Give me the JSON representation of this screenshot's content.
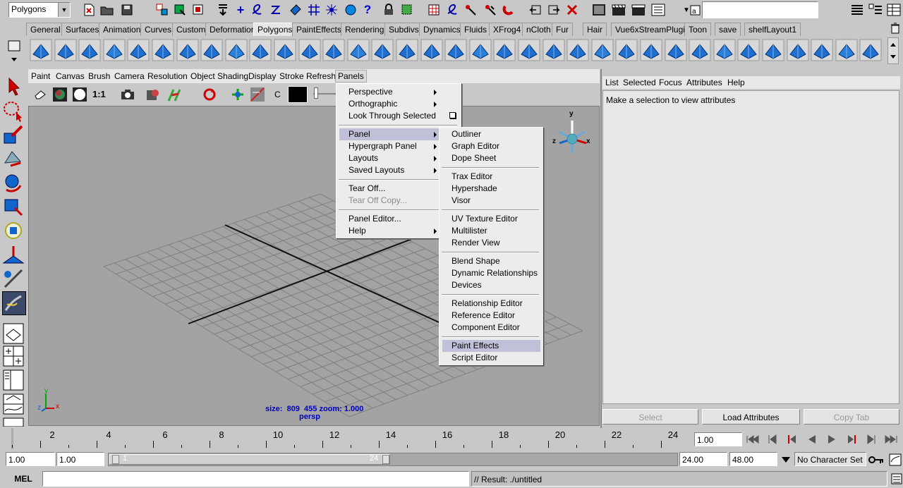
{
  "status_line": {
    "mode_selector": "Polygons",
    "quick_field": "",
    "icons": [
      "new-scene-icon",
      "open-scene-icon",
      "save-scene-icon",
      "select-by-hierarchy-icon",
      "select-by-object-icon",
      "select-by-component-icon",
      "snap-grid-icon",
      "snap-curve-icon",
      "snap-point-icon",
      "snap-plane-icon",
      "make-live-icon",
      "construction-history-icon",
      "render-icon",
      "ipr-render-icon",
      "render-globals-icon",
      "show-hypershade-icon",
      "render-view-icon",
      "magnet-icon",
      "quick-field-type-icon"
    ]
  },
  "shelf": {
    "tabs": [
      "General",
      "Surfaces",
      "Animation",
      "Curves",
      "Custom",
      "Deformation",
      "Polygons",
      "PaintEffects",
      "Rendering",
      "Subdivs",
      "Dynamics",
      "Fluids",
      "XFrog4",
      "nCloth",
      "Fur",
      "Hair",
      "Vue6xStreamPlugin",
      "Toon",
      "save",
      "shelfLayout1"
    ],
    "active_tab": "Polygons"
  },
  "panel_menubar": [
    "Paint",
    "Canvas",
    "Brush",
    "Camera",
    "Resolution",
    "Object Shading",
    "Display",
    "Stroke Refresh",
    "Panels"
  ],
  "panel_toolbar": {
    "label_c": "C",
    "ratio_label": "1:1"
  },
  "viewport": {
    "size_readout": "size:  809  455 zoom: 1.000",
    "camera_label": "persp",
    "axis_y": "y",
    "axis_x": "x",
    "axis_z": "z"
  },
  "panels_menu": {
    "items": [
      {
        "label": "Perspective",
        "submenu": true
      },
      {
        "label": "Orthographic",
        "submenu": true
      },
      {
        "label": "Look Through Selected",
        "option_box": true
      },
      {
        "label": "Panel",
        "submenu": true,
        "highlighted": true
      },
      {
        "label": "Hypergraph Panel",
        "submenu": true
      },
      {
        "label": "Layouts",
        "submenu": true
      },
      {
        "label": "Saved Layouts",
        "submenu": true
      },
      {
        "label": "Tear Off..."
      },
      {
        "label": "Tear Off Copy...",
        "disabled": true
      },
      {
        "label": "Panel Editor..."
      },
      {
        "label": "Help",
        "submenu": true
      }
    ]
  },
  "panel_submenu": {
    "items": [
      "Outliner",
      "Graph Editor",
      "Dope Sheet",
      "Trax Editor",
      "Hypershade",
      "Visor",
      "UV Texture Editor",
      "Multilister",
      "Render View",
      "Blend Shape",
      "Dynamic Relationships",
      "Devices",
      "Relationship Editor",
      "Reference Editor",
      "Component Editor",
      "Paint Effects",
      "Script Editor"
    ],
    "highlighted": "Paint Effects"
  },
  "attribute_editor": {
    "menu": [
      "List",
      "Selected",
      "Focus",
      "Attributes",
      "Help"
    ],
    "message": "Make a selection to view attributes",
    "buttons": {
      "select": "Select",
      "load": "Load Attributes",
      "copy": "Copy Tab"
    }
  },
  "time_slider": {
    "ticks": [
      "2",
      "4",
      "6",
      "8",
      "10",
      "12",
      "14",
      "16",
      "18",
      "20",
      "22",
      "24"
    ],
    "current_time": "1.00"
  },
  "range_slider": {
    "start_time": "1.00",
    "playback_start": "1.00",
    "slider_start": "1",
    "slider_end": "24",
    "playback_end": "24.00",
    "end_time": "48.00",
    "character_set": "No Character Set"
  },
  "command_line": {
    "label": "MEL",
    "result": "// Result: ./untitled"
  },
  "colors": {
    "background": "#c8c8c8",
    "viewport": "#a3a3a3",
    "highlight": "#c0c0d8",
    "readout": "#0000c0"
  }
}
